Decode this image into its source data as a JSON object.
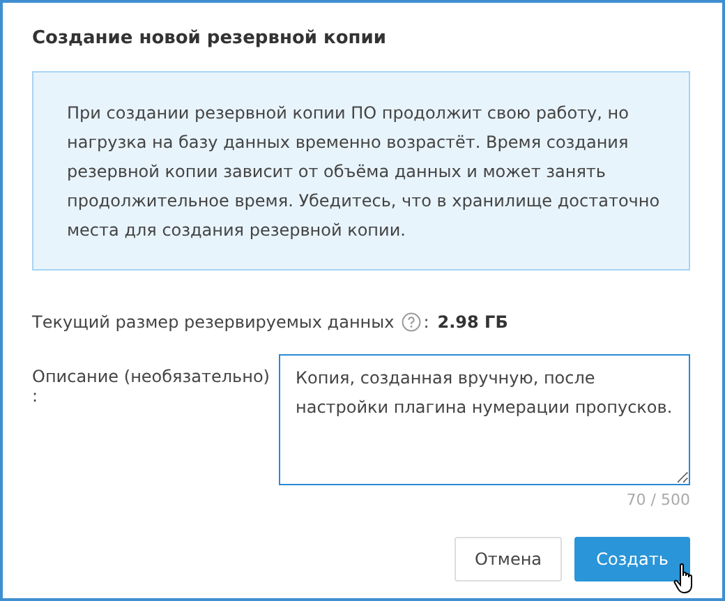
{
  "dialog": {
    "title": "Создание новой резервной копии",
    "notice": "При создании резервной копии ПО продолжит свою работу, но нагрузка на базу данных временно возрастёт. Время создания резервной копии зависит от объёма данных и может занять продолжительное время. Убедитесь, что в хранилище достаточно места для создания резервной копии.",
    "size_label": "Текущий размер резервируемых данных",
    "size_separator": ":",
    "size_value": "2.98 ГБ",
    "description_label": "Описание (необязательно) :",
    "description_value": "Копия, созданная вручную, после настройки плагина нумерации пропусков.",
    "counter": "70 / 500",
    "buttons": [
      {
        "label": "Отмена",
        "kind": "secondary"
      },
      {
        "label": "Создать",
        "kind": "primary"
      }
    ]
  }
}
